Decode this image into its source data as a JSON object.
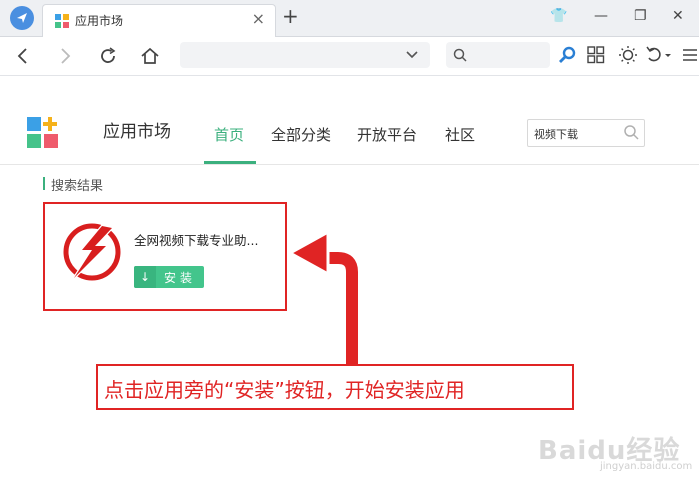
{
  "browser": {
    "tab_title": "应用市场",
    "tab_close": "×",
    "new_tab": "+",
    "window_buttons": [
      "👕",
      "—",
      "❐",
      "✕"
    ],
    "url_value": "",
    "toolbar_icons": [
      "back-icon",
      "forward-icon",
      "refresh-icon",
      "home-icon",
      "search-icon",
      "grid-icon",
      "brightness-icon",
      "undo-icon",
      "menu-icon"
    ]
  },
  "site": {
    "name": "应用市场",
    "nav": [
      {
        "label": "首页",
        "active": true
      },
      {
        "label": "全部分类",
        "active": false
      },
      {
        "label": "开放平台",
        "active": false
      },
      {
        "label": "社区",
        "active": false
      }
    ],
    "search_value": "视频下载",
    "accent_color": "#3bb07e"
  },
  "results": {
    "label": "搜索结果",
    "items": [
      {
        "name": "全网视频下载专业助...",
        "install_label": "安装"
      }
    ]
  },
  "annotation": {
    "text": "点击应用旁的“安装”按钮，开始安装应用",
    "color": "#e02424"
  },
  "watermark": {
    "text": "Baidu经验",
    "sub": "jingyan.baidu.com"
  }
}
